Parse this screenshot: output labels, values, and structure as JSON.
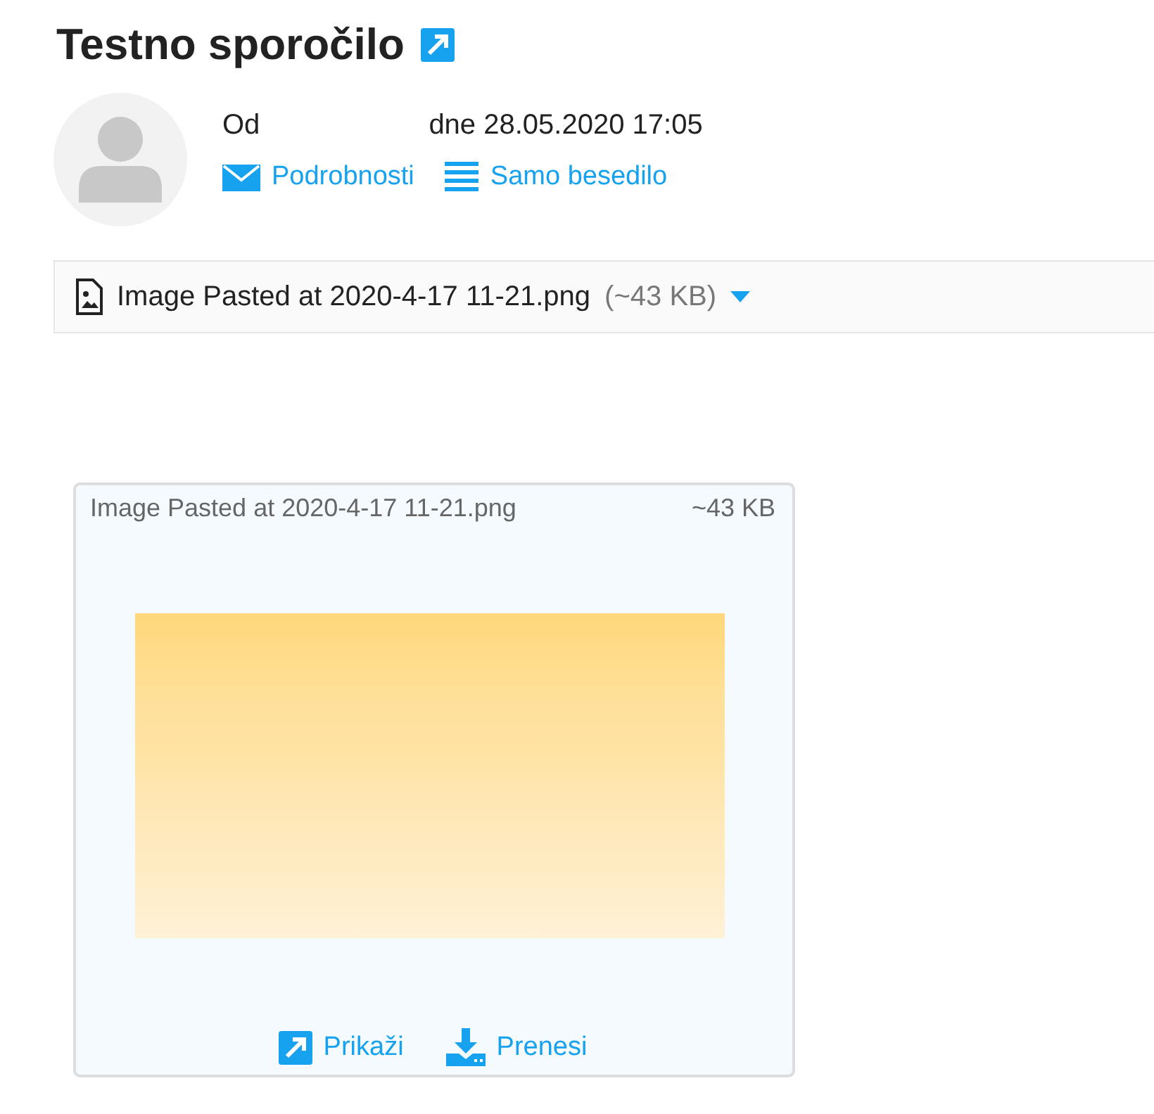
{
  "title": "Testno sporočilo",
  "header": {
    "from_label": "Od",
    "date": "dne 28.05.2020 17:05",
    "links": [
      {
        "kind": "details",
        "label": "Podrobnosti"
      },
      {
        "kind": "plain",
        "label": "Samo besedilo"
      }
    ]
  },
  "attachment_bar": {
    "name": "Image Pasted at 2020-4-17 11-21.png",
    "size": "(~43 KB)"
  },
  "preview": {
    "name": "Image Pasted at 2020-4-17 11-21.png",
    "size": "~43 KB",
    "actions": [
      {
        "kind": "open",
        "label": "Prikaži"
      },
      {
        "kind": "download",
        "label": "Prenesi"
      }
    ]
  }
}
